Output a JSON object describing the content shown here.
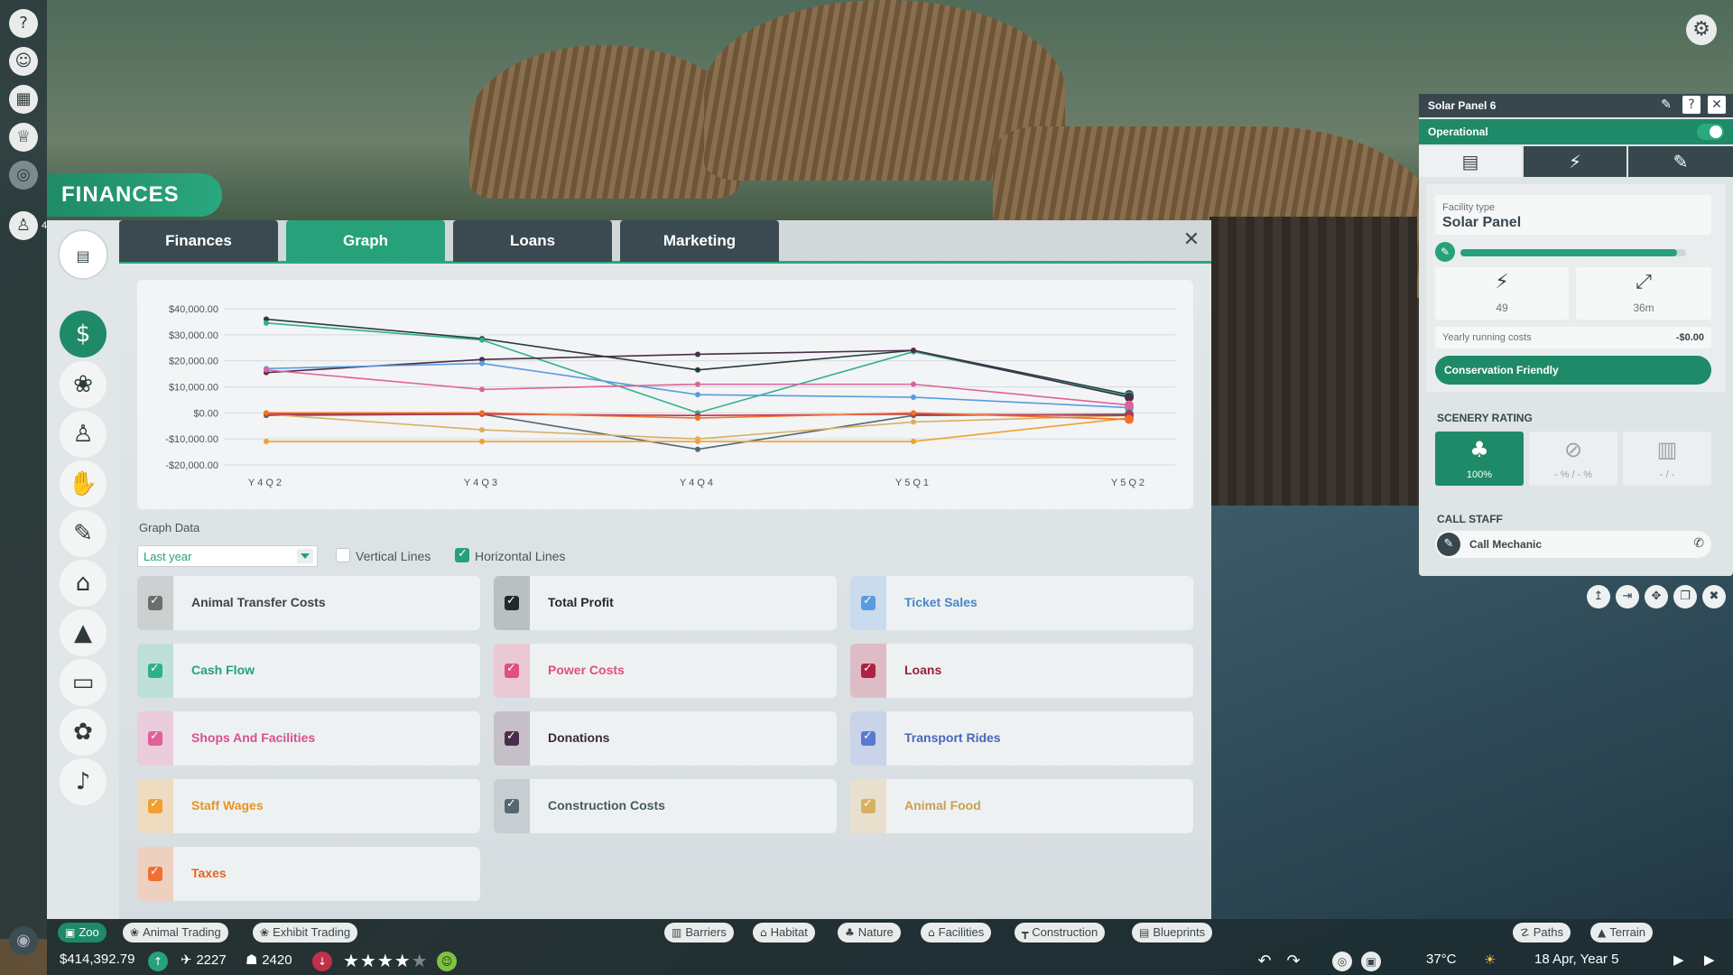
{
  "finances_title": "FINANCES",
  "tabs": [
    "Finances",
    "Graph",
    "Loans",
    "Marketing"
  ],
  "active_tab": "Graph",
  "rail_badge": "4",
  "chart_data": {
    "type": "line",
    "categories": [
      "Y4Q2",
      "Y4Q3",
      "Y4Q4",
      "Y5Q1",
      "Y5Q2"
    ],
    "ylim": [
      -20000,
      40000
    ],
    "y_ticks": [
      "$40,000.00",
      "$30,000.00",
      "$20,000.00",
      "$10,000.00",
      "$0.00",
      "-$10,000.00",
      "-$20,000.00"
    ],
    "y_tick_values": [
      40000,
      30000,
      20000,
      10000,
      0,
      -10000,
      -20000
    ],
    "grid": "horizontal",
    "series": [
      {
        "name": "Total Profit",
        "color": "#2b3a40",
        "values": [
          36000,
          28500,
          16500,
          24000,
          7000
        ]
      },
      {
        "name": "Cash Flow",
        "color": "#2fb08a",
        "values": [
          34500,
          28000,
          0,
          23500,
          6500
        ]
      },
      {
        "name": "Donations",
        "color": "#4a2d4a",
        "values": [
          15500,
          20500,
          22500,
          24000,
          6000
        ]
      },
      {
        "name": "Ticket Sales",
        "color": "#5a9be0",
        "values": [
          17000,
          19000,
          7000,
          6000,
          2000
        ]
      },
      {
        "name": "Shops And Facilities",
        "color": "#e0609a",
        "values": [
          16500,
          9000,
          11000,
          11000,
          3000
        ]
      },
      {
        "name": "Construction Costs",
        "color": "#546870",
        "values": [
          -1000,
          -500,
          -14000,
          -1000,
          -500
        ]
      },
      {
        "name": "Animal Food",
        "color": "#d9b060",
        "values": [
          -500,
          -6500,
          -10000,
          -3500,
          -1000
        ]
      },
      {
        "name": "Staff Wages",
        "color": "#f0a030",
        "values": [
          -11000,
          -11000,
          -11000,
          -11000,
          -2000
        ]
      },
      {
        "name": "Loans",
        "color": "#c0304a",
        "values": [
          -500,
          -500,
          -1000,
          -500,
          -1000
        ]
      },
      {
        "name": "Taxes",
        "color": "#f07030",
        "values": [
          0,
          0,
          -2000,
          0,
          -2500
        ]
      }
    ]
  },
  "graph_data_label": "Graph Data",
  "period_select": "Last year",
  "vertical_lines": {
    "label": "Vertical Lines",
    "checked": false
  },
  "horizontal_lines": {
    "label": "Horizontal Lines",
    "checked": true
  },
  "items": [
    {
      "label": "Animal Transfer Costs",
      "color": "#6b6f6e",
      "text_color": "#3a4549"
    },
    {
      "label": "Total Profit",
      "color": "#1f2a2e",
      "text_color": "#1f2a2e"
    },
    {
      "label": "Ticket Sales",
      "color": "#5a9be0",
      "text_color": "#4a86c8"
    },
    {
      "label": "Cash Flow",
      "color": "#2fb08a",
      "text_color": "#26a17a"
    },
    {
      "label": "Power Costs",
      "color": "#e0507a",
      "text_color": "#e0507a"
    },
    {
      "label": "Loans",
      "color": "#b02040",
      "text_color": "#9a2038"
    },
    {
      "label": "Shops And Facilities",
      "color": "#e0609a",
      "text_color": "#d8508c"
    },
    {
      "label": "Donations",
      "color": "#4a2d4a",
      "text_color": "#3a2a3a"
    },
    {
      "label": "Transport Rides",
      "color": "#5a7ad0",
      "text_color": "#4a66b8"
    },
    {
      "label": "Staff Wages",
      "color": "#f0a030",
      "text_color": "#e89420"
    },
    {
      "label": "Construction Costs",
      "color": "#546870",
      "text_color": "#485a60"
    },
    {
      "label": "Animal Food",
      "color": "#d9b060",
      "text_color": "#c8a050"
    },
    {
      "label": "Taxes",
      "color": "#f07030",
      "text_color": "#e86420"
    }
  ],
  "panel": {
    "title": "Solar Panel 6",
    "status": "Operational",
    "facility_type_label": "Facility type",
    "facility_type": "Solar Panel",
    "condition": 0.96,
    "power_value": "49",
    "range_value": "36m",
    "running_costs_label": "Yearly running costs",
    "running_costs_value": "-$0.00",
    "conservation": "Conservation Friendly",
    "scenery_title": "SCENERY RATING",
    "scenery": [
      "100%",
      "- % / - %",
      "- / -"
    ],
    "call_staff_title": "CALL STAFF",
    "call_mechanic": "Call Mechanic"
  },
  "bottom_tabs": [
    "Zoo",
    "Animal Trading",
    "Exhibit Trading",
    "Barriers",
    "Habitat",
    "Nature",
    "Facilities",
    "Construction",
    "Blueprints",
    "Paths",
    "Terrain"
  ],
  "money": "$414,392.79",
  "guests": "2227",
  "animals": "2420",
  "rating_stars": 4,
  "temperature": "37°C",
  "date": "18 Apr, Year 5"
}
